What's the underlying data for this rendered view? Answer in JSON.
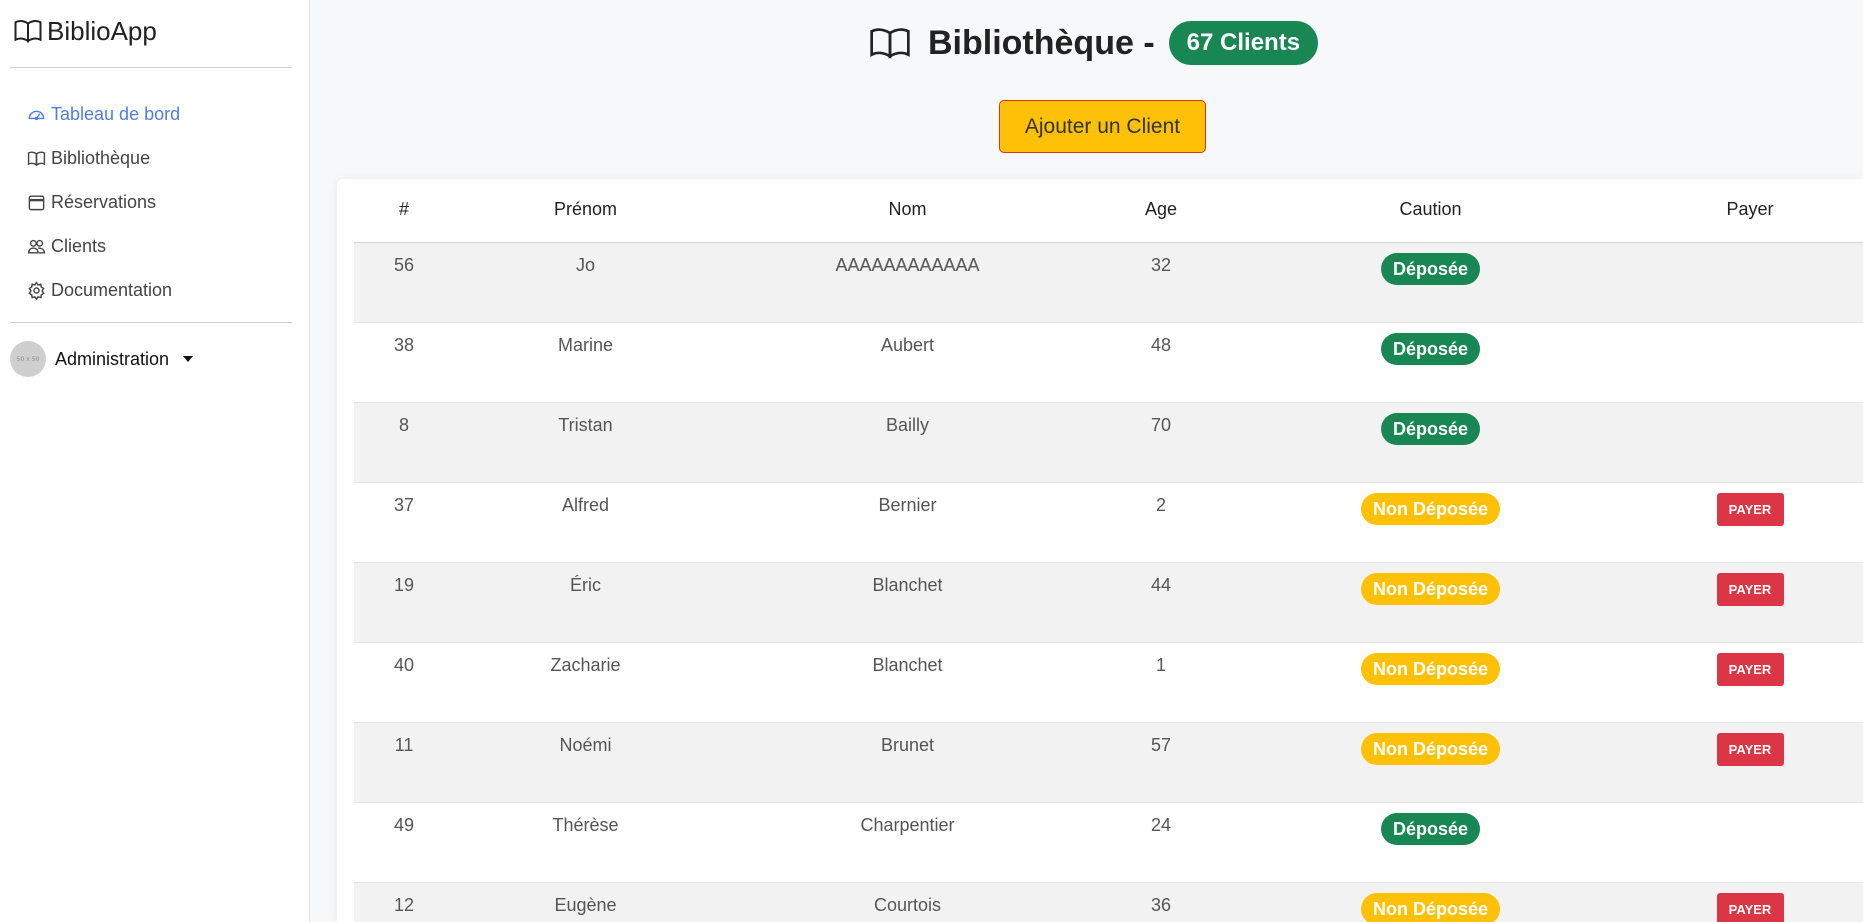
{
  "app": {
    "name": "BiblioApp"
  },
  "sidebar": {
    "items": [
      {
        "label": "Tableau de bord",
        "icon": "speedometer-icon",
        "active": true
      },
      {
        "label": "Bibliothèque",
        "icon": "book-icon",
        "active": false
      },
      {
        "label": "Réservations",
        "icon": "calendar-icon",
        "active": false
      },
      {
        "label": "Clients",
        "icon": "people-icon",
        "active": false
      },
      {
        "label": "Documentation",
        "icon": "gear-icon",
        "active": false
      }
    ],
    "user": {
      "avatar_text": "50 x 50",
      "label": "Administration"
    }
  },
  "header": {
    "title": "Bibliothèque -",
    "count_badge": "67 Clients",
    "add_button": "Ajouter un Client"
  },
  "colors": {
    "accent": "#4f7de8",
    "success": "#198754",
    "warning": "#ffc107",
    "danger": "#dc3545"
  },
  "table": {
    "columns": [
      "#",
      "Prénom",
      "Nom",
      "Age",
      "Caution",
      "Payer"
    ],
    "pay_label": "PAYER",
    "rows": [
      {
        "id": "56",
        "prenom": "Jo",
        "nom": "AAAAAAAAAAAA",
        "age": "32",
        "caution": "Déposée",
        "deposited": true
      },
      {
        "id": "38",
        "prenom": "Marine",
        "nom": "Aubert",
        "age": "48",
        "caution": "Déposée",
        "deposited": true
      },
      {
        "id": "8",
        "prenom": "Tristan",
        "nom": "Bailly",
        "age": "70",
        "caution": "Déposée",
        "deposited": true
      },
      {
        "id": "37",
        "prenom": "Alfred",
        "nom": "Bernier",
        "age": "2",
        "caution": "Non Déposée",
        "deposited": false
      },
      {
        "id": "19",
        "prenom": "Éric",
        "nom": "Blanchet",
        "age": "44",
        "caution": "Non Déposée",
        "deposited": false
      },
      {
        "id": "40",
        "prenom": "Zacharie",
        "nom": "Blanchet",
        "age": "1",
        "caution": "Non Déposée",
        "deposited": false
      },
      {
        "id": "11",
        "prenom": "Noémi",
        "nom": "Brunet",
        "age": "57",
        "caution": "Non Déposée",
        "deposited": false
      },
      {
        "id": "49",
        "prenom": "Thérèse",
        "nom": "Charpentier",
        "age": "24",
        "caution": "Déposée",
        "deposited": true
      },
      {
        "id": "12",
        "prenom": "Eugène",
        "nom": "Courtois",
        "age": "36",
        "caution": "Non Déposée",
        "deposited": false
      }
    ]
  }
}
